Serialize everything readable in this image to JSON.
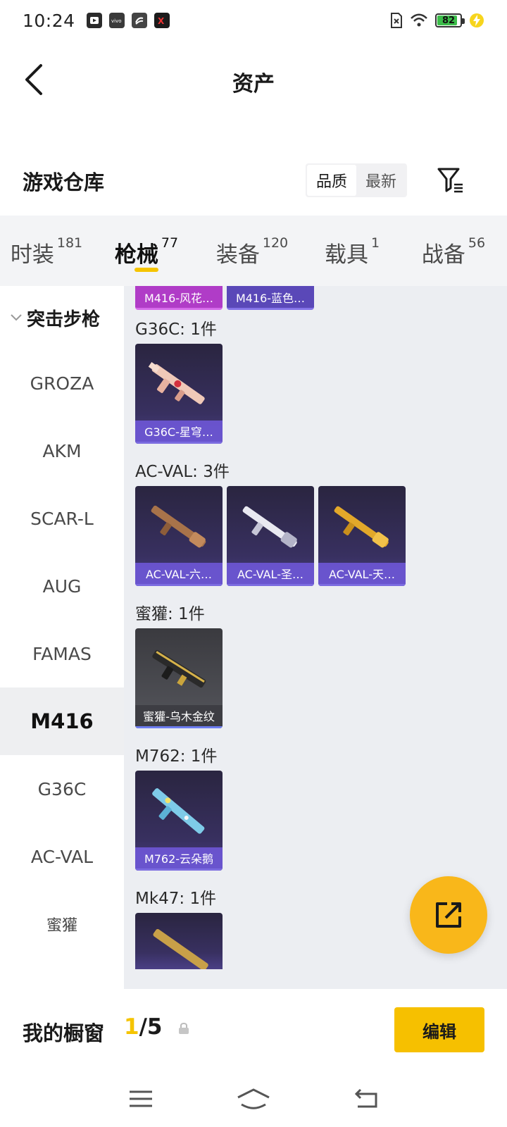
{
  "status_bar": {
    "time": "10:24",
    "battery": "82",
    "notification_icons": [
      "video-icon",
      "vivo-icon",
      "link-icon",
      "game-icon"
    ]
  },
  "header": {
    "title": "资产"
  },
  "section": {
    "title": "游戏仓库",
    "sort_options": [
      "品质",
      "最新"
    ],
    "active_sort": "品质"
  },
  "tabs": [
    {
      "label": "时装",
      "count": "181"
    },
    {
      "label": "枪械",
      "count": "77"
    },
    {
      "label": "装备",
      "count": "120"
    },
    {
      "label": "载具",
      "count": "1"
    },
    {
      "label": "战备",
      "count": "56"
    }
  ],
  "active_tab": "枪械",
  "sidebar": {
    "group_label": "突击步枪",
    "items": [
      "GROZA",
      "AKM",
      "SCAR-L",
      "AUG",
      "FAMAS",
      "M416",
      "G36C",
      "AC-VAL",
      "蜜獾"
    ],
    "active_item": "M416"
  },
  "content": {
    "top_strip": [
      "M416-风花…",
      "M416-蓝色…"
    ],
    "groups": [
      {
        "title": "G36C: 1件",
        "cards": [
          "G36C-星穹…"
        ]
      },
      {
        "title": "AC-VAL: 3件",
        "cards": [
          "AC-VAL-六…",
          "AC-VAL-圣…",
          "AC-VAL-天…"
        ]
      },
      {
        "title": "蜜獾: 1件",
        "cards": [
          "蜜獾-乌木金纹"
        ]
      },
      {
        "title": "M762: 1件",
        "cards": [
          "M762-云朵鹅"
        ]
      },
      {
        "title": "Mk47: 1件",
        "cards": []
      }
    ]
  },
  "bottom_bar": {
    "showcase_label": "我的橱窗",
    "showcase_current": "1",
    "showcase_sep": "/",
    "showcase_total": "5",
    "edit_label": "编辑"
  },
  "colors": {
    "accent": "#f5c400",
    "card_label": "#6c55d2",
    "fab": "#f9b71a"
  }
}
